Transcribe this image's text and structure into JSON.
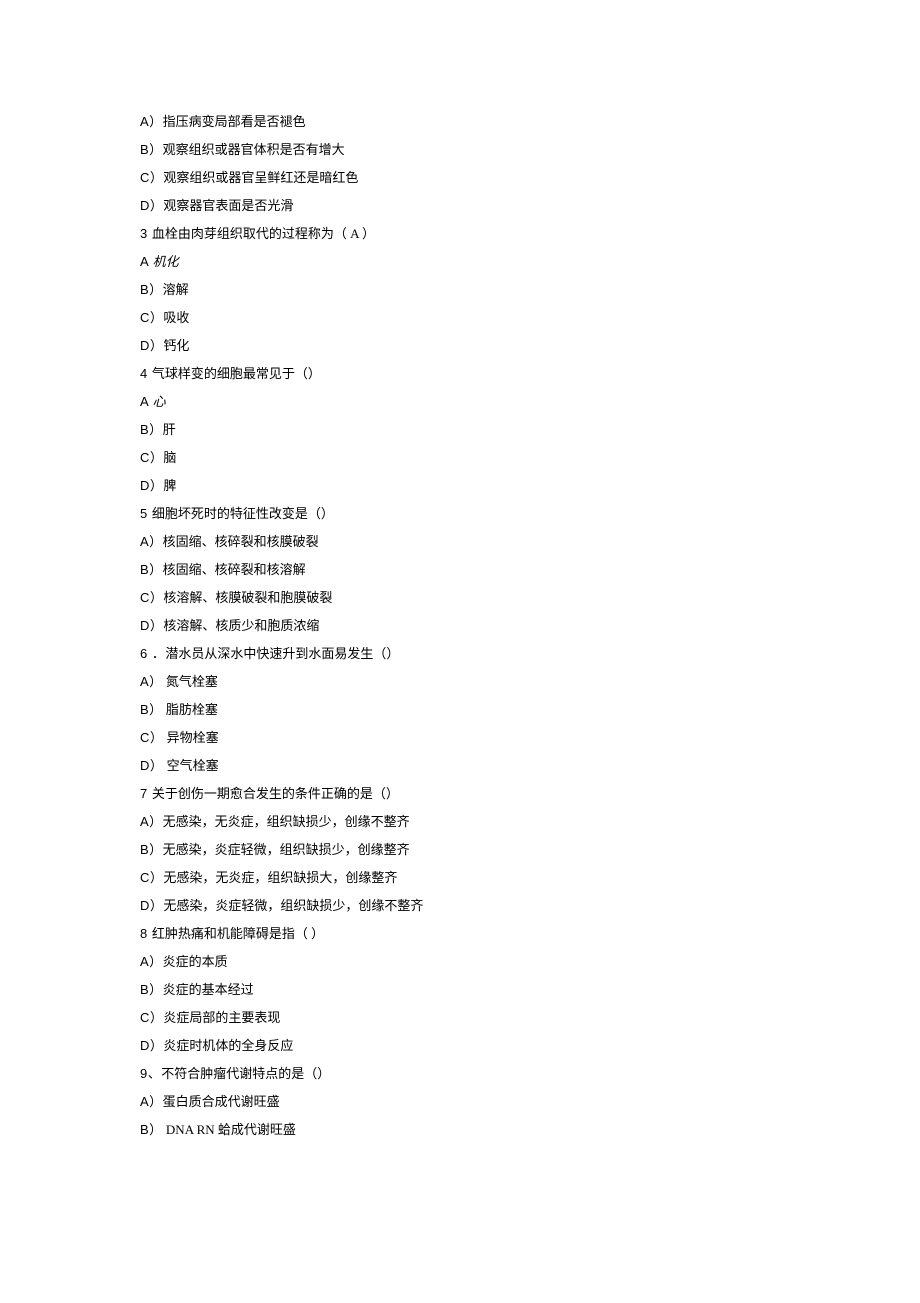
{
  "lines": [
    {
      "label": "A）",
      "text": "指压病变局部看是否褪色"
    },
    {
      "label": "B）",
      "text": "观察组织或器官体积是否有增大"
    },
    {
      "label": "C）",
      "text": "观察组织或器官呈鲜红还是暗红色"
    },
    {
      "label": "D）",
      "text": "观察器官表面是否光滑"
    },
    {
      "label": "3 ",
      "text": "血栓由肉芽组织取代的过程称为（ A ）"
    },
    {
      "label": "A ",
      "text": "机化",
      "answer": true
    },
    {
      "label": "B）",
      "text": "溶解"
    },
    {
      "label": "C）",
      "text": "吸收"
    },
    {
      "label": "D）",
      "text": "钙化"
    },
    {
      "label": "4 ",
      "text": "气球样变的细胞最常见于（）"
    },
    {
      "label": "A ",
      "text": "心",
      "answer": true
    },
    {
      "label": "B）",
      "text": "肝"
    },
    {
      "label": "C）",
      "text": "脑"
    },
    {
      "label": "D）",
      "text": "脾"
    },
    {
      "label": "5 ",
      "text": "细胞坏死时的特征性改变是（）"
    },
    {
      "label": "A）",
      "text": "核固缩、核碎裂和核膜破裂"
    },
    {
      "label": "B）",
      "text": "核固缩、核碎裂和核溶解"
    },
    {
      "label": "C）",
      "text": "核溶解、核膜破裂和胞膜破裂"
    },
    {
      "label": "D）",
      "text": "核溶解、核质少和胞质浓缩"
    },
    {
      "label": "6 ．",
      "text": "潜水员从深水中快速升到水面易发生（）"
    },
    {
      "label": "A）",
      "text": "  氮气栓塞"
    },
    {
      "label": "B）",
      "text": "  脂肪栓塞"
    },
    {
      "label": "C）",
      "text": "  异物栓塞"
    },
    {
      "label": "D）",
      "text": "  空气栓塞"
    },
    {
      "label": "7 ",
      "text": "关于创伤一期愈合发生的条件正确的是（）"
    },
    {
      "label": "A）",
      "text": "无感染，无炎症，组织缺损少，创缘不整齐"
    },
    {
      "label": "B）",
      "text": "无感染，炎症轻微，组织缺损少，创缘整齐"
    },
    {
      "label": "C）",
      "text": "无感染，无炎症，组织缺损大，创缘整齐"
    },
    {
      "label": "D）",
      "text": "无感染，炎症轻微，组织缺损少，创缘不整齐"
    },
    {
      "label": "8 ",
      "text": "红肿热痛和机能障碍是指（ ）"
    },
    {
      "label": "A）",
      "text": "炎症的本质"
    },
    {
      "label": "B）",
      "text": "炎症的基本经过"
    },
    {
      "label": "C）",
      "text": "炎症局部的主要表现"
    },
    {
      "label": "D）",
      "text": "炎症时机体的全身反应"
    },
    {
      "label": "9、",
      "text": "不符合肿瘤代谢特点的是（）"
    },
    {
      "label": "A）",
      "text": "蛋白质合成代谢旺盛"
    },
    {
      "label": "B）",
      "text": " DNA RN 蛤成代谢旺盛"
    }
  ]
}
